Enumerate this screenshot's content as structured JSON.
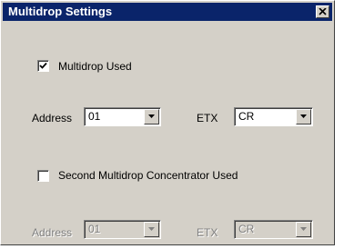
{
  "window": {
    "title": "Multidrop Settings",
    "close_icon": "close-icon"
  },
  "primary": {
    "checkbox_label": "Multidrop Used",
    "checked": true,
    "address_label": "Address",
    "address_value": "01",
    "etx_label": "ETX",
    "etx_value": "CR"
  },
  "secondary": {
    "checkbox_label": "Second Multidrop Concentrator Used",
    "checked": false,
    "address_label": "Address",
    "address_value": "01",
    "etx_label": "ETX",
    "etx_value": "CR",
    "enabled": false
  },
  "colors": {
    "titlebar": "#0a246a",
    "face": "#d4d0c8",
    "disabled_text": "#808080"
  }
}
